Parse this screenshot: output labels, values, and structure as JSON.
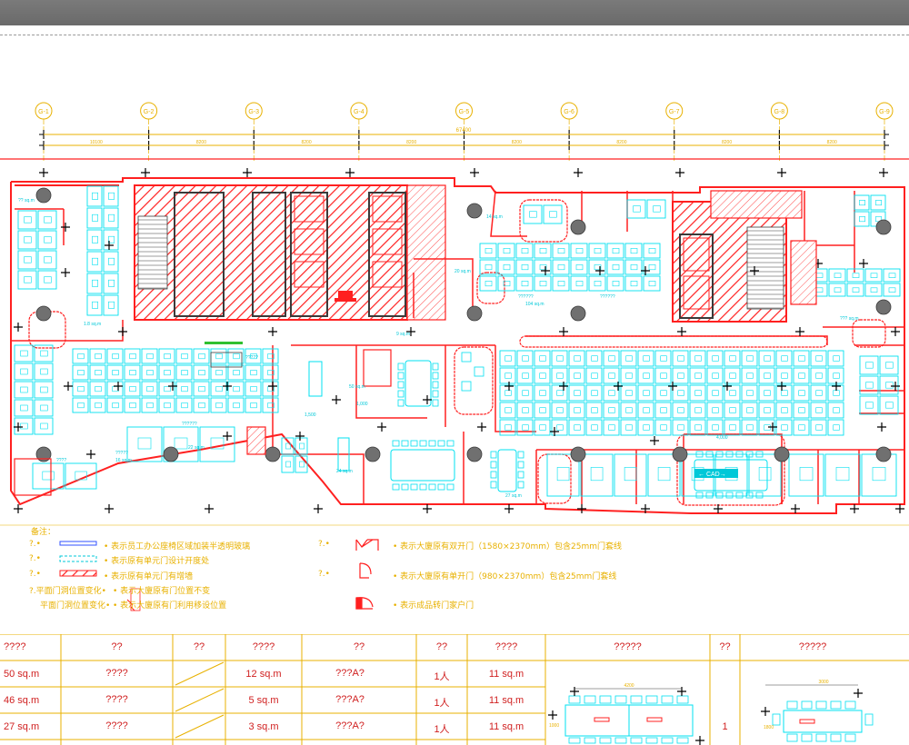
{
  "grid": {
    "axes": [
      "G-1",
      "G-2",
      "G-3",
      "G-4",
      "G-5",
      "G-6",
      "G-7",
      "G-8",
      "G-9"
    ],
    "total_dim": "67400",
    "spans": [
      "10100",
      "8200",
      "8200",
      "8200",
      "8200",
      "8200",
      "8200",
      "8200"
    ]
  },
  "rooms": {
    "r1": "?? sq.m",
    "r2": "14 sq.m",
    "r3": "??????",
    "r4": "20 sq.m",
    "r5": "1.8 sq.m",
    "r6": "??????",
    "r7": "104 sq.m",
    "r8": "??????",
    "r9": "9 sq.m",
    "r10": "????",
    "r11": "?????",
    "r12": "16 sq.m",
    "r13": "27 sq.m",
    "r14": "24 sq.m",
    "r15": "22 sq.m",
    "r16": "??? sq.m",
    "r17": "50 sq.m",
    "r18": "1,000",
    "r19": "1,500",
    "r20": "?????",
    "r21": "4,000",
    "dim_cad": "← CAD→"
  },
  "legend": {
    "title": "备注：",
    "items": [
      {
        "marker": "?.•",
        "text": "• 表示员工办公座椅区域加装半透明玻璃"
      },
      {
        "marker": "?.•",
        "text": "• 表示原有单元门设计开度处"
      },
      {
        "marker": "?.•",
        "text": "• 表示原有单元门有增墙"
      },
      {
        "marker": "?.平面门洞位置变化•",
        "text": "• 表示大廈原有门位置不变"
      },
      {
        "marker": "平面门洞位置变化•",
        "text": "• 表示大廈原有门利用移设位置"
      },
      {
        "marker": "?.•",
        "text": "• 表示大廈原有双开门（1580×2370mm）包含25mm门套线"
      },
      {
        "marker": "?.•",
        "text": "• 表示大廈原有单开门（980×2370mm）包含25mm门套线"
      },
      {
        "marker": "?.•",
        "text": "• 表示成品转门家户门"
      }
    ]
  },
  "table": {
    "headers": [
      "????",
      "??",
      "??",
      "????",
      "??",
      "??",
      "????",
      "?????",
      "??",
      "?????"
    ],
    "rows": [
      [
        "50 sq.m",
        "????",
        "12 sq.m",
        "???A?",
        "1人",
        "11 sq.m"
      ],
      [
        "46 sq.m",
        "????",
        "5 sq.m",
        "???A?",
        "1人",
        "11 sq.m"
      ],
      [
        "27 sq.m",
        "????",
        "3 sq.m",
        "???A?",
        "1人",
        "11 sq.m"
      ]
    ],
    "detail_dims": [
      "4200",
      "1000",
      "3000",
      "1800"
    ],
    "detail_count": "1"
  },
  "colors": {
    "wall": "#ff2020",
    "furniture": "#00e0f0",
    "grid": "#e8b100",
    "dark": "#3a3a3a",
    "column": "#707070"
  }
}
